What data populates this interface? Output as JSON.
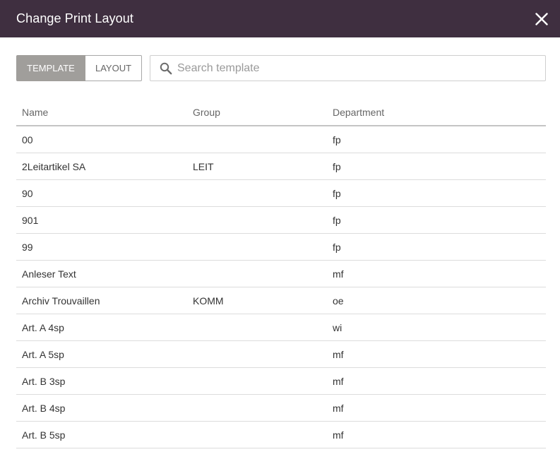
{
  "dialog": {
    "title": "Change Print Layout",
    "close_icon": "close-icon"
  },
  "tabs": [
    {
      "label": "TEMPLATE",
      "active": true
    },
    {
      "label": "LAYOUT",
      "active": false
    }
  ],
  "search": {
    "placeholder": "Search template",
    "value": "",
    "icon": "search-icon"
  },
  "table": {
    "columns": [
      "Name",
      "Group",
      "Department"
    ],
    "rows": [
      {
        "name": "00",
        "group": "",
        "department": "fp"
      },
      {
        "name": "2Leitartikel SA",
        "group": "LEIT",
        "department": "fp"
      },
      {
        "name": "90",
        "group": "",
        "department": "fp"
      },
      {
        "name": "901",
        "group": "",
        "department": "fp"
      },
      {
        "name": "99",
        "group": "",
        "department": "fp"
      },
      {
        "name": "Anleser Text",
        "group": "",
        "department": "mf"
      },
      {
        "name": "Archiv Trouvaillen",
        "group": "KOMM",
        "department": "oe"
      },
      {
        "name": "Art. A 4sp",
        "group": "",
        "department": "wi"
      },
      {
        "name": "Art. A 5sp",
        "group": "",
        "department": "mf"
      },
      {
        "name": "Art. B 3sp",
        "group": "",
        "department": "mf"
      },
      {
        "name": "Art. B 4sp",
        "group": "",
        "department": "mf"
      },
      {
        "name": "Art. B 5sp",
        "group": "",
        "department": "mf"
      }
    ]
  },
  "colors": {
    "header_bg": "#3f2f40",
    "active_tab_bg": "#a09e9b"
  }
}
